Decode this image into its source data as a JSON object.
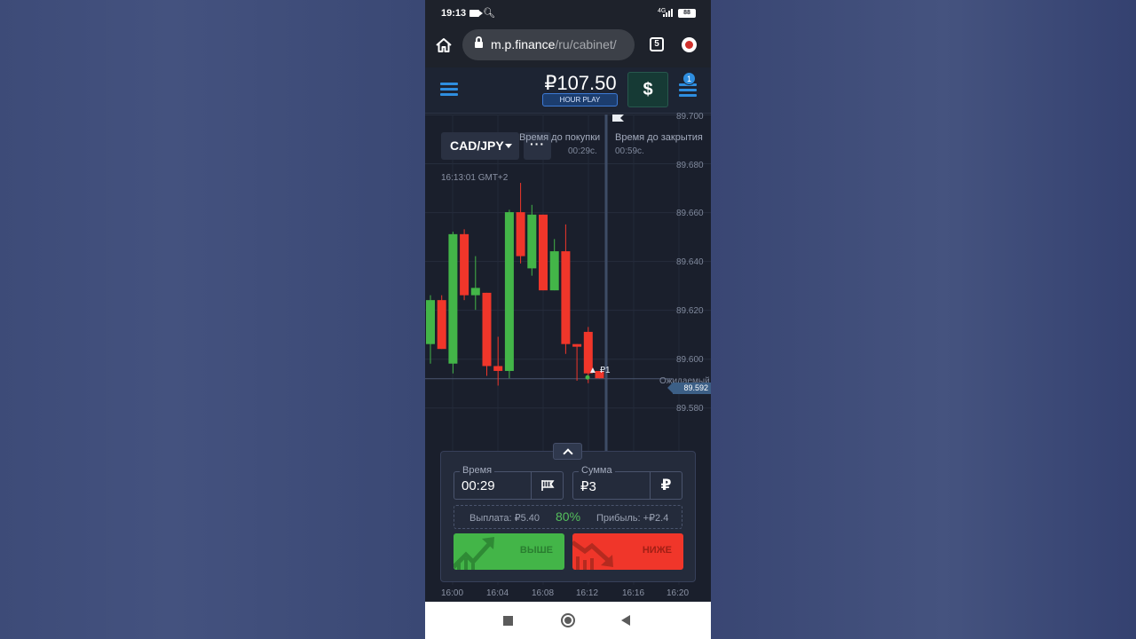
{
  "status_bar": {
    "time": "19:13",
    "network": "4G",
    "battery": "88"
  },
  "browser": {
    "url_host": "m.p.finance",
    "url_path": "/ru/cabinet/",
    "tab_count": "5"
  },
  "header": {
    "balance": "₽107.50",
    "account_type": "HOUR PLAY",
    "deposit_symbol": "$",
    "notifications": "1"
  },
  "chart": {
    "pair": "CAD/JPY",
    "more_label": "···",
    "server_time": "16:13:01 GMT+2",
    "time_to_buy_label": "Время до покупки",
    "time_to_buy_value": "00:29c.",
    "time_to_close_label": "Время до закрытия",
    "time_to_close_value": "00:59c.",
    "expected_label": "Ожидаемый",
    "current_price": "89.592",
    "trade_marker": "₽1",
    "y_ticks": [
      "89.700",
      "89.680",
      "89.660",
      "89.640",
      "89.620",
      "89.600",
      "89.580"
    ],
    "x_ticks": [
      "16:00",
      "16:04",
      "16:08",
      "16:12",
      "16:16",
      "16:20"
    ]
  },
  "chart_data": {
    "type": "candlestick",
    "ylim": [
      89.575,
      89.7
    ],
    "up_color": "#43b548",
    "down_color": "#f0362a",
    "candles": [
      {
        "o": 89.606,
        "h": 89.626,
        "l": 89.598,
        "c": 89.624
      },
      {
        "o": 89.624,
        "h": 89.626,
        "l": 89.604,
        "c": 89.604
      },
      {
        "o": 89.598,
        "h": 89.652,
        "l": 89.594,
        "c": 89.651
      },
      {
        "o": 89.651,
        "h": 89.653,
        "l": 89.624,
        "c": 89.626
      },
      {
        "o": 89.626,
        "h": 89.642,
        "l": 89.62,
        "c": 89.629
      },
      {
        "o": 89.627,
        "h": 89.627,
        "l": 89.593,
        "c": 89.597
      },
      {
        "o": 89.597,
        "h": 89.609,
        "l": 89.589,
        "c": 89.595
      },
      {
        "o": 89.595,
        "h": 89.661,
        "l": 89.592,
        "c": 89.66
      },
      {
        "o": 89.66,
        "h": 89.672,
        "l": 89.639,
        "c": 89.642
      },
      {
        "o": 89.637,
        "h": 89.663,
        "l": 89.634,
        "c": 89.659
      },
      {
        "o": 89.659,
        "h": 89.659,
        "l": 89.628,
        "c": 89.628
      },
      {
        "o": 89.628,
        "h": 89.649,
        "l": 89.628,
        "c": 89.644
      },
      {
        "o": 89.644,
        "h": 89.655,
        "l": 89.602,
        "c": 89.606
      },
      {
        "o": 89.606,
        "h": 89.606,
        "l": 89.591,
        "c": 89.605
      },
      {
        "o": 89.611,
        "h": 89.613,
        "l": 89.59,
        "c": 89.594
      },
      {
        "o": 89.595,
        "h": 89.595,
        "l": 89.592,
        "c": 89.592
      }
    ]
  },
  "trade_panel": {
    "time_label": "Время",
    "time_value": "00:29",
    "amount_label": "Сумма",
    "amount_value": "₽3",
    "currency_symbol": "₽",
    "payout_label": "Выплата: ₽5.40",
    "payout_percent": "80%",
    "profit_label": "Прибыль: +₽2.4",
    "up_label": "ВЫШЕ",
    "down_label": "НИЖЕ"
  }
}
